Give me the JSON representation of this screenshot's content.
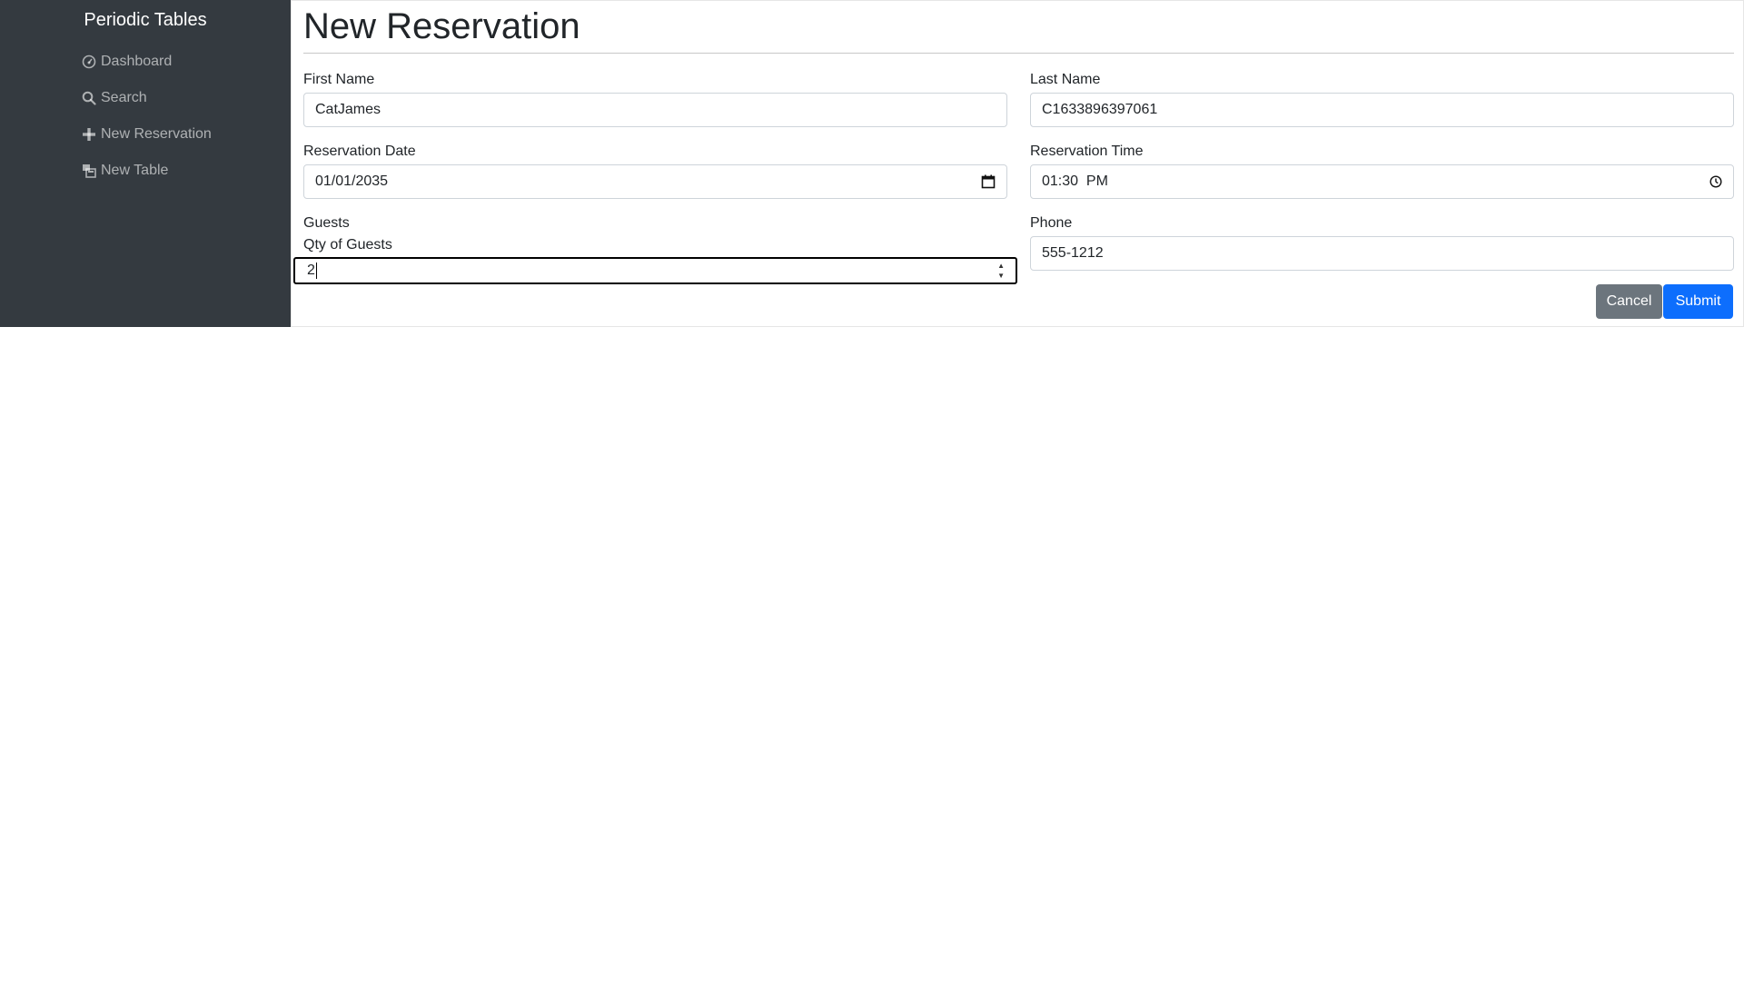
{
  "sidebar": {
    "brand": "Periodic Tables",
    "items": [
      {
        "label": "Dashboard",
        "icon": "dashboard-icon"
      },
      {
        "label": "Search",
        "icon": "search-icon"
      },
      {
        "label": "New Reservation",
        "icon": "plus-icon"
      },
      {
        "label": "New Table",
        "icon": "table-icon"
      }
    ]
  },
  "page": {
    "title": "New Reservation"
  },
  "form": {
    "first_name": {
      "label": "First Name",
      "value": "CatJames"
    },
    "last_name": {
      "label": "Last Name",
      "value": "C1633896397061"
    },
    "reservation_date": {
      "label": "Reservation Date",
      "value": "01/01/2035"
    },
    "reservation_time": {
      "label": "Reservation Time",
      "value": "01:30  PM"
    },
    "guests": {
      "label": "Guests",
      "sublabel": "Qty of Guests",
      "value": "2"
    },
    "phone": {
      "label": "Phone",
      "value": "555-1212"
    }
  },
  "actions": {
    "cancel_label": "Cancel",
    "submit_label": "Submit"
  },
  "colors": {
    "sidebar_bg": "#343a40",
    "cancel_bg": "#6c757d",
    "submit_bg": "#0d6efd"
  }
}
